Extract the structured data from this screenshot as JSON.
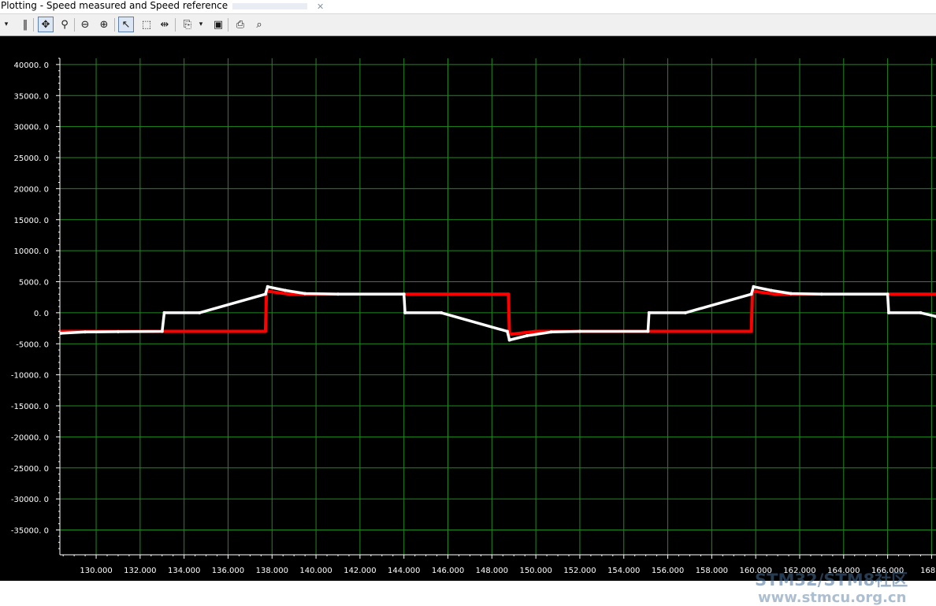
{
  "window": {
    "title": "Plotting  - Speed measured and Speed reference"
  },
  "toolbar": {
    "icons": [
      {
        "name": "menu-dropdown-icon",
        "glyph": "▾"
      },
      {
        "name": "pause-icon",
        "glyph": "‖"
      },
      {
        "name": "pan-icon",
        "glyph": "✥"
      },
      {
        "name": "zoom-fit-icon",
        "glyph": "⚲"
      },
      {
        "name": "zoom-out-icon",
        "glyph": "⊖"
      },
      {
        "name": "zoom-in-icon",
        "glyph": "⊕"
      },
      {
        "name": "select-pointer-icon",
        "glyph": "↖"
      },
      {
        "name": "rectangle-select-icon",
        "glyph": "⬚"
      },
      {
        "name": "cursor-markers-icon",
        "glyph": "⇹"
      },
      {
        "name": "copy-icon",
        "glyph": "⎘"
      },
      {
        "name": "copy-dropdown-icon",
        "glyph": "▾"
      },
      {
        "name": "save-icon",
        "glyph": "▣"
      },
      {
        "name": "print-icon",
        "glyph": "⎙"
      },
      {
        "name": "print-preview-icon",
        "glyph": "⌕"
      }
    ]
  },
  "colors": {
    "background": "#000000",
    "grid": "#1f8a1f",
    "axis": "#ffffff",
    "measured": "#ffffff",
    "reference": "#ff0000"
  },
  "chart_data": {
    "type": "line",
    "title": "Speed measured and Speed reference",
    "xlim": [
      128.35,
      168.2
    ],
    "ylim": [
      -39000,
      41000
    ],
    "x_ticks": [
      130,
      132,
      134,
      136,
      138,
      140,
      142,
      144,
      146,
      148,
      150,
      152,
      154,
      156,
      158,
      160,
      162,
      164,
      166,
      168
    ],
    "x_tick_labels": [
      "130.000",
      "132.000",
      "134.000",
      "136.000",
      "138.000",
      "140.000",
      "142.000",
      "144.000",
      "146.000",
      "148.000",
      "150.000",
      "152.000",
      "154.000",
      "156.000",
      "158.000",
      "160.000",
      "162.000",
      "164.000",
      "166.000",
      "168.0"
    ],
    "y_ticks": [
      40000,
      35000,
      30000,
      25000,
      20000,
      15000,
      10000,
      5000,
      0,
      -5000,
      -10000,
      -15000,
      -20000,
      -25000,
      -30000,
      -35000
    ],
    "y_tick_labels": [
      "40000. 0",
      "35000. 0",
      "30000. 0",
      "25000. 0",
      "20000. 0",
      "15000. 0",
      "10000. 0",
      "5000. 0",
      "0. 0",
      "-5000. 0",
      "-10000. 0",
      "-15000. 0",
      "-20000. 0",
      "-25000. 0",
      "-30000. 0",
      "-35000. 0"
    ],
    "grid": true,
    "series": [
      {
        "color": "#ff0000",
        "points": [
          [
            128.35,
            -3000
          ],
          [
            133.1,
            -3000
          ],
          [
            137.7,
            -3000
          ],
          [
            137.75,
            3500
          ],
          [
            138.8,
            3000
          ],
          [
            148.75,
            3000
          ],
          [
            148.8,
            -3500
          ],
          [
            150.0,
            -3000
          ],
          [
            155.0,
            -3000
          ],
          [
            159.8,
            -3000
          ],
          [
            159.85,
            3500
          ],
          [
            160.9,
            3000
          ],
          [
            168.2,
            3000
          ]
        ]
      },
      {
        "color": "#ffffff",
        "points": [
          [
            128.4,
            -3300
          ],
          [
            129.5,
            -3100
          ],
          [
            131.0,
            -3050
          ],
          [
            133.0,
            -3000
          ],
          [
            133.1,
            0
          ],
          [
            134.7,
            0
          ],
          [
            137.7,
            3000
          ],
          [
            137.8,
            4200
          ],
          [
            138.6,
            3600
          ],
          [
            139.5,
            3100
          ],
          [
            141.0,
            3000
          ],
          [
            144.0,
            3000
          ],
          [
            144.05,
            0
          ],
          [
            145.7,
            0
          ],
          [
            148.7,
            -3000
          ],
          [
            148.8,
            -4400
          ],
          [
            149.6,
            -3700
          ],
          [
            150.7,
            -3100
          ],
          [
            152.0,
            -3000
          ],
          [
            155.1,
            -3000
          ],
          [
            155.15,
            0
          ],
          [
            156.8,
            0
          ],
          [
            159.8,
            3000
          ],
          [
            159.9,
            4200
          ],
          [
            160.7,
            3600
          ],
          [
            161.6,
            3100
          ],
          [
            163.0,
            3000
          ],
          [
            166.0,
            3000
          ],
          [
            166.05,
            0
          ],
          [
            167.5,
            0
          ],
          [
            168.2,
            -600
          ]
        ]
      }
    ]
  },
  "watermark": {
    "line1": "STM32/STM8社区",
    "line2": "www.stmcu.org.cn"
  }
}
